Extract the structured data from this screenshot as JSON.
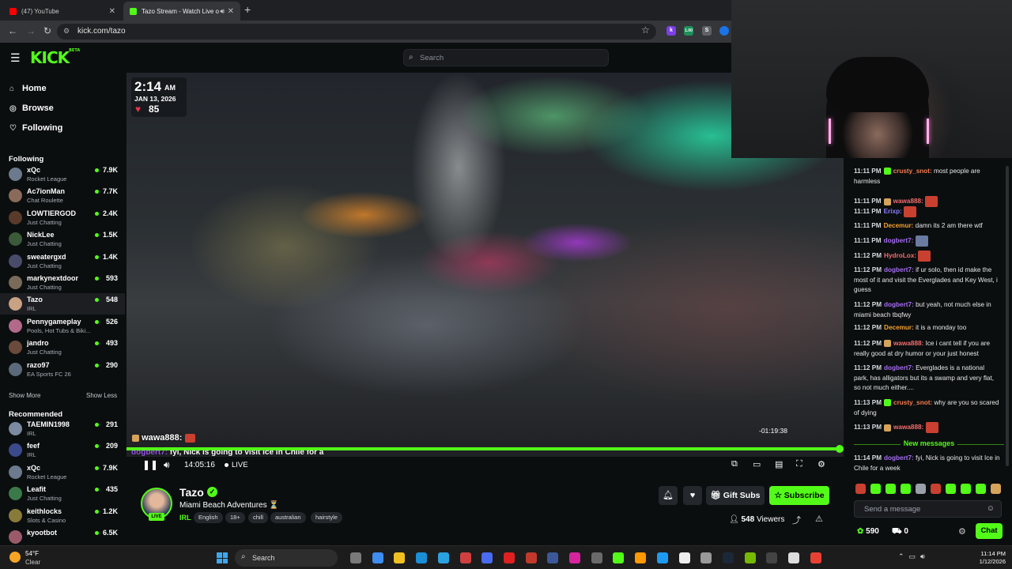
{
  "browser": {
    "tabs": [
      {
        "title": "(47) YouTube",
        "favicon_color": "#ff0000"
      },
      {
        "title": "Tazo Stream - Watch Live o",
        "favicon_color": "#53fc18"
      }
    ],
    "url": "kick.com/tazo",
    "extensions": [
      {
        "label": "k",
        "color": "#7b3fe4"
      },
      {
        "label": "1.00",
        "color": "#1e8f5a"
      },
      {
        "label": "S",
        "color": "#5f6368"
      },
      {
        "label": "",
        "color": "#1a73e8"
      }
    ]
  },
  "header": {
    "logo": "KICK",
    "logo_badge": "BETA",
    "search_placeholder": "Search"
  },
  "sidebar": {
    "nav": [
      {
        "label": "Home",
        "icon": "home-icon"
      },
      {
        "label": "Browse",
        "icon": "compass-icon"
      },
      {
        "label": "Following",
        "icon": "heart-icon"
      }
    ],
    "following_heading": "Following",
    "following": [
      {
        "name": "xQc",
        "category": "Rocket League",
        "viewers": "7.9K",
        "avatar_color": "#6b7a8c"
      },
      {
        "name": "Ac7ionMan",
        "category": "Chat Roulette",
        "viewers": "7.7K",
        "avatar_color": "#8a6b5a"
      },
      {
        "name": "LOWTIERGOD",
        "category": "Just Chatting",
        "viewers": "2.4K",
        "avatar_color": "#5a3a2a"
      },
      {
        "name": "NickLee",
        "category": "Just Chatting",
        "viewers": "1.5K",
        "avatar_color": "#3a5a3a"
      },
      {
        "name": "sweatergxd",
        "category": "Just Chatting",
        "viewers": "1.4K",
        "avatar_color": "#4a4a6a"
      },
      {
        "name": "markynextdoor",
        "category": "Just Chatting",
        "viewers": "593",
        "avatar_color": "#7a6a5a"
      },
      {
        "name": "Tazo",
        "category": "IRL",
        "viewers": "548",
        "avatar_color": "#c9a183"
      },
      {
        "name": "Pennygameplay",
        "category": "Pools, Hot Tubs & Biki...",
        "viewers": "526",
        "avatar_color": "#b36a8a"
      },
      {
        "name": "jandro",
        "category": "Just Chatting",
        "viewers": "493",
        "avatar_color": "#6a4a3a"
      },
      {
        "name": "razo97",
        "category": "EA Sports FC 26",
        "viewers": "290",
        "avatar_color": "#5a6a7a"
      }
    ],
    "show_more": "Show More",
    "show_less": "Show Less",
    "recommended_heading": "Recommended",
    "recommended": [
      {
        "name": "TAEMIN1998",
        "category": "IRL",
        "viewers": "291",
        "avatar_color": "#7a8aa0"
      },
      {
        "name": "feef",
        "category": "IRL",
        "viewers": "209",
        "avatar_color": "#3a4a8a"
      },
      {
        "name": "xQc",
        "category": "Rocket League",
        "viewers": "7.9K",
        "avatar_color": "#6b7a8c"
      },
      {
        "name": "Leafit",
        "category": "Just Chatting",
        "viewers": "435",
        "avatar_color": "#3a7a4a"
      },
      {
        "name": "keithlocks",
        "category": "Slots & Casino",
        "viewers": "1.2K",
        "avatar_color": "#8a7a3a"
      },
      {
        "name": "kyootbot",
        "category": "",
        "viewers": "6.5K",
        "avatar_color": "#9a5a6a"
      }
    ]
  },
  "video": {
    "overlay_time": "2:14",
    "overlay_ampm": "AM",
    "overlay_date": "JAN 13, 2026",
    "overlay_heart_rate": "85",
    "overlay_chat_user": "wawa888:",
    "overlay_chat_msg_user": "dogbert7:",
    "overlay_chat_msg": "fyi, Nick is going to visit Ice in Chile for a",
    "remaining": "-01:19:38",
    "progress_fraction": 0.995,
    "elapsed": "14:05:16",
    "live_label": "LIVE"
  },
  "stream": {
    "streamer": "Tazo",
    "title": "Miami Beach Adventures ⏳",
    "category": "IRL",
    "tags": [
      "English",
      "18+",
      "chill",
      "australian",
      "hairstyle"
    ],
    "gift_subs": "Gift Subs",
    "subscribe": "Subscribe",
    "viewers_count": "548",
    "viewers_label": "Viewers",
    "live_badge": "LIVE"
  },
  "chat": {
    "messages": [
      {
        "time": "11:11 PM",
        "user": "crusty_snot:",
        "color": "#f77b4e",
        "text": "most people are harmless",
        "badge": "#53fc18"
      },
      {
        "time": "11:11 PM",
        "user": "wawa888:",
        "color": "#f36d6d",
        "text": "",
        "badge": "#d6a35a",
        "emote": "#c94030"
      },
      {
        "time": "11:11 PM",
        "user": "Erixp:",
        "color": "#8a7cff",
        "text": "",
        "emote": "#c94030"
      },
      {
        "time": "11:11 PM",
        "user": "Decemur:",
        "color": "#f4a12e",
        "text": "damn its 2 am there wtf"
      },
      {
        "time": "11:11 PM",
        "user": "dogbert7:",
        "color": "#a56cf2",
        "text": "",
        "emote": "#6a7aa0"
      },
      {
        "time": "11:12 PM",
        "user": "HydroLox:",
        "color": "#f36d6d",
        "text": "",
        "emote": "#c94030"
      },
      {
        "time": "11:12 PM",
        "user": "dogbert7:",
        "color": "#a56cf2",
        "text": "if ur solo, then id make the most of it and visit the Everglades and Key West, i guess"
      },
      {
        "time": "11:12 PM",
        "user": "dogbert7:",
        "color": "#a56cf2",
        "text": "but yeah, not much else in miami beach tbqfwy"
      },
      {
        "time": "11:12 PM",
        "user": "Decemur:",
        "color": "#f4a12e",
        "text": "it is a monday too"
      },
      {
        "time": "11:12 PM",
        "user": "wawa888:",
        "color": "#f36d6d",
        "text": "Ice i cant tell if you are really good at dry humor or your just honest",
        "badge": "#d6a35a"
      },
      {
        "time": "11:12 PM",
        "user": "dogbert7:",
        "color": "#a56cf2",
        "text": "Everglades is a national park, has alligators but its a swamp and very flat, so not much either...."
      },
      {
        "time": "11:13 PM",
        "user": "crusty_snot:",
        "color": "#f77b4e",
        "text": "why are you so scared of dying",
        "badge": "#53fc18"
      },
      {
        "time": "11:13 PM",
        "user": "wawa888:",
        "color": "#f36d6d",
        "text": "",
        "badge": "#d6a35a",
        "emote": "#c94030"
      }
    ],
    "new_messages": "New messages",
    "latest": {
      "time": "11:14 PM",
      "user": "dogbert7:",
      "color": "#a56cf2",
      "text": "fyi, Nick is going to visit Ice in Chile for a week"
    },
    "emote_colors": [
      "#c94030",
      "#53fc18",
      "#53fc18",
      "#53fc18",
      "#9aa0a8",
      "#c94030",
      "#53fc18",
      "#53fc18",
      "#53fc18",
      "#d6a35a"
    ],
    "input_placeholder": "Send a message",
    "points": "590",
    "drops": "0",
    "chat_button": "Chat"
  },
  "taskbar": {
    "temp": "54°F",
    "condition": "Clear",
    "search_label": "Search",
    "time": "11:14 PM",
    "date": "1/12/2026",
    "app_colors": [
      "#7a7a7a",
      "#3d8ef0",
      "#f0c020",
      "#1a8fd6",
      "#2aa2e0",
      "#d04040",
      "#4a6af0",
      "#e02020",
      "#c0392b",
      "#3b5998",
      "#d6249f",
      "#6a6a6a",
      "#53fc18",
      "#ff9900",
      "#1d9bf0",
      "#eeeeee",
      "#999999",
      "#1b2838",
      "#76b900",
      "#444444",
      "#dddddd",
      "#e84133"
    ]
  }
}
